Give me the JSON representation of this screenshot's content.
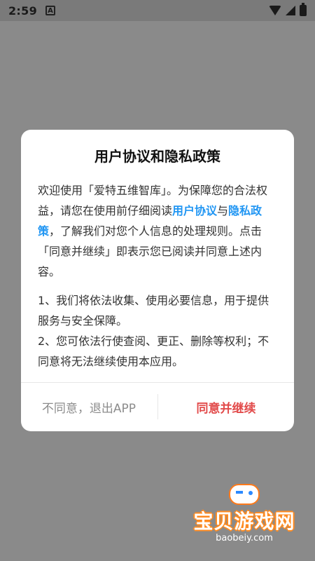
{
  "status_bar": {
    "time": "2:59",
    "notification_icon_label": "A",
    "icons": [
      "wifi-icon",
      "signal-icon",
      "battery-icon"
    ]
  },
  "dialog": {
    "title": "用户协议和隐私政策",
    "paragraph1_text_a": "欢迎使用「爱特五维智库」。为保障您的合法权益，请您在使用前仔细阅读",
    "link_user_agreement": "用户协议",
    "paragraph1_text_b": "与",
    "link_privacy_policy": "隐私政策",
    "paragraph1_text_c": "，了解我们对您个人信息的处理规则。点击「同意并继续」即表示您已阅读并同意上述内容。",
    "paragraph2_line1": "1、我们将依法收集、使用必要信息，用于提供服务与安全保障。",
    "paragraph2_line2": "2、您可依法行使查阅、更正、删除等权利；不同意将无法继续使用本应用。",
    "disagree_label": "不同意，退出APP",
    "agree_label": "同意并继续",
    "colors": {
      "link": "#2196f3",
      "agree": "#e24b4b",
      "disagree": "#8c8c8c"
    }
  },
  "watermark": {
    "brand": "宝贝游戏网",
    "url": "baobeiy.com"
  }
}
